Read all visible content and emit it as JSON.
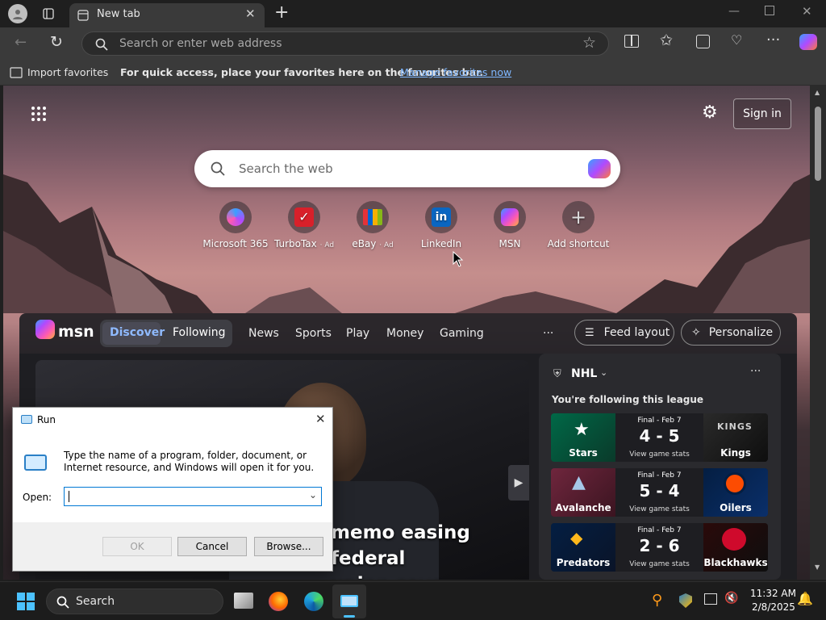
{
  "browser": {
    "tab_title": "New tab",
    "address_placeholder": "Search or enter web address",
    "import_favorites": "Import favorites",
    "favbar_message": "For quick access, place your favorites here on the favorites bar.",
    "manage_favorites": "Manage favorites now"
  },
  "newtab": {
    "sign_in": "Sign in",
    "search_placeholder": "Search the web",
    "shortcuts": [
      {
        "label": "Microsoft 365",
        "ad": ""
      },
      {
        "label": "TurboTax",
        "ad": "· Ad"
      },
      {
        "label": "eBay",
        "ad": "· Ad"
      },
      {
        "label": "LinkedIn",
        "ad": ""
      },
      {
        "label": "MSN",
        "ad": ""
      },
      {
        "label": "Add shortcut",
        "ad": ""
      }
    ]
  },
  "msn": {
    "logo": "msn",
    "tabs": [
      "Discover",
      "Following"
    ],
    "nav": [
      "News",
      "Sports",
      "Play",
      "Money",
      "Gaming"
    ],
    "more": "···",
    "feed_layout": "Feed layout",
    "personalize": "Personalize",
    "headline_line1": "memo easing federal",
    "headline_line2": "union says"
  },
  "nhl": {
    "title": "NHL",
    "following": "You're following this league",
    "more": "···",
    "games": [
      {
        "status": "Final - Feb 7",
        "score": "4 - 5",
        "home": "Stars",
        "away": "Kings",
        "link": "View game stats"
      },
      {
        "status": "Final - Feb 7",
        "score": "5 - 4",
        "home": "Avalanche",
        "away": "Oilers",
        "link": "View game stats"
      },
      {
        "status": "Final - Feb 7",
        "score": "2 - 6",
        "home": "Predators",
        "away": "Blackhawks",
        "link": "View game stats"
      }
    ]
  },
  "run_dialog": {
    "title": "Run",
    "description": "Type the name of a program, folder, document, or Internet resource, and Windows will open it for you.",
    "open_label": "Open:",
    "ok": "OK",
    "cancel": "Cancel",
    "browse": "Browse..."
  },
  "taskbar": {
    "search": "Search",
    "time": "11:32 AM",
    "date": "2/8/2025"
  },
  "colors": {
    "accent": "#0a84ff",
    "link": "#7fb7ff"
  }
}
